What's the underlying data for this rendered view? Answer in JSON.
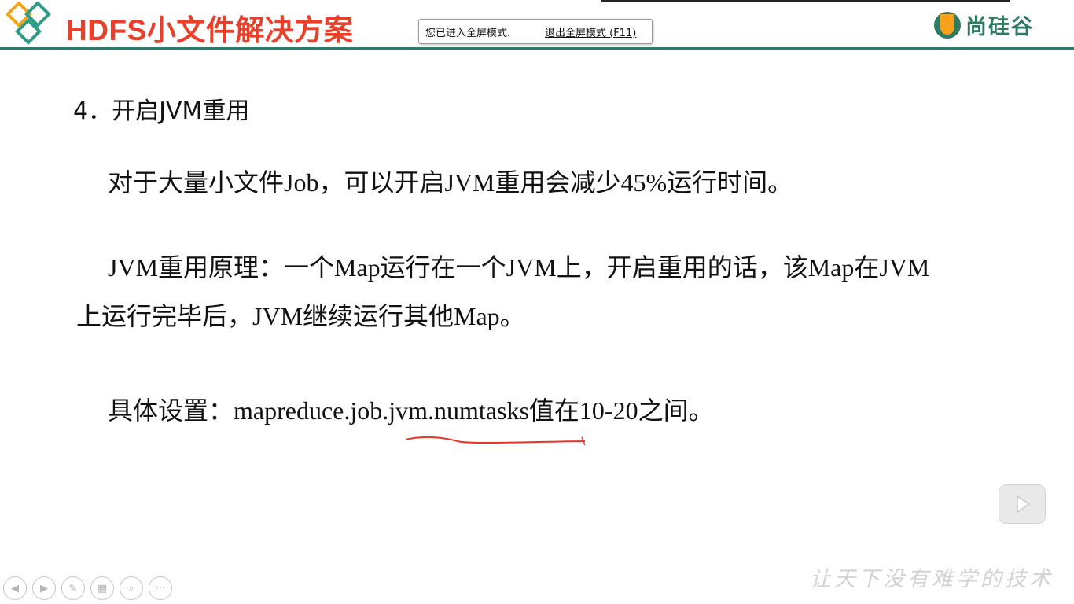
{
  "header": {
    "title": "HDFS小文件解决方案",
    "brand": "尚硅谷",
    "accent_color": "#e8402a",
    "rule_color": "#2f7a6b"
  },
  "fullscreen_tip": {
    "message": "您已进入全屏模式.",
    "exit_label": "退出全屏模式 (F11)"
  },
  "slide": {
    "heading": "4．开启JVM重用",
    "paragraph1": "对于大量小文件Job，可以开启JVM重用会减少45%运行时间。",
    "paragraph2_line1": "JVM重用原理：一个Map运行在一个JVM上，开启重用的话，该Map在JVM",
    "paragraph2_line2": "上运行完毕后，JVM继续运行其他Map。",
    "paragraph3": "具体设置：mapreduce.job.jvm.numtasks值在10-20之间。"
  },
  "footer": {
    "slogan": "让天下没有难学的技术"
  },
  "controls": [
    {
      "icon": "previous-icon",
      "glyph": "◀"
    },
    {
      "icon": "next-icon",
      "glyph": "▶"
    },
    {
      "icon": "pen-icon",
      "glyph": "✎"
    },
    {
      "icon": "slides-icon",
      "glyph": "▦"
    },
    {
      "icon": "zoom-icon",
      "glyph": "⌕"
    },
    {
      "icon": "more-icon",
      "glyph": "···"
    }
  ]
}
